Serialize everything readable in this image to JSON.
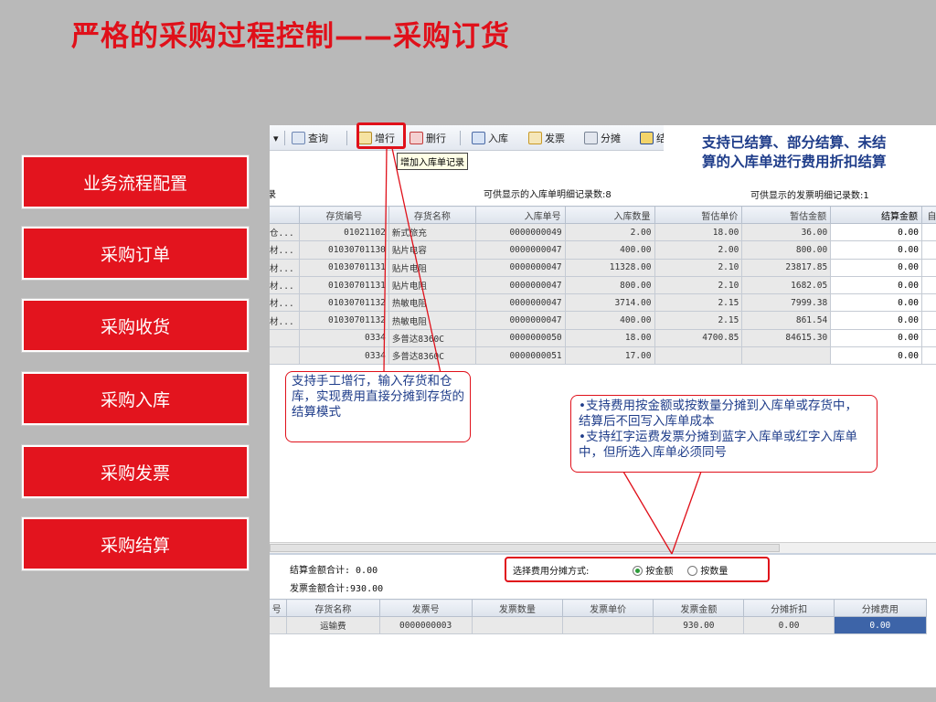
{
  "slide": {
    "title": "严格的采购过程控制——采购订货",
    "nav": [
      "业务流程配置",
      "采购订单",
      "采购收货",
      "采购入库",
      "采购发票",
      "采购结算"
    ]
  },
  "toolbar": {
    "query": "查询",
    "add_row": "增行",
    "delete_row": "删行",
    "stock_in": "入库",
    "invoice": "发票",
    "allocate": "分摊",
    "settle": "结算",
    "tooltip": "增加入库单记录"
  },
  "callouts": {
    "top_right": [
      "支持已结算、部分结算、未结",
      "算的入库单进行费用折扣结算"
    ],
    "left": "支持手工增行，输入存货和仓库，实现费用直接分摊到存货的结算模式",
    "right": [
      "•支持费用按金额或按数量分摊到入库单或存货中，结算后不回写入库单成本",
      "•支持红字运费发票分摊到蓝字入库单或红字入库单中，但所选入库单必须同号"
    ]
  },
  "upper_grid": {
    "label_left": "录",
    "count_receipt": "可供显示的入库单明细记录数:8",
    "count_invoice": "可供显示的发票明细记录数:1",
    "columns": [
      "",
      "存货编号",
      "存货名称",
      "入库单号",
      "入库数量",
      "暂估单价",
      "暂估金额",
      "结算金额",
      "自"
    ],
    "rows": [
      [
        "仓...",
        "01021102",
        "新式旅充",
        "0000000049",
        "2.00",
        "18.00",
        "36.00",
        "0.00"
      ],
      [
        "材...",
        "01030701130",
        "贴片电容",
        "0000000047",
        "400.00",
        "2.00",
        "800.00",
        "0.00"
      ],
      [
        "材...",
        "01030701131",
        "贴片电阻",
        "0000000047",
        "11328.00",
        "2.10",
        "23817.85",
        "0.00"
      ],
      [
        "材...",
        "01030701131",
        "贴片电阻",
        "0000000047",
        "800.00",
        "2.10",
        "1682.05",
        "0.00"
      ],
      [
        "材...",
        "01030701132",
        "热敏电阻",
        "0000000047",
        "3714.00",
        "2.15",
        "7999.38",
        "0.00"
      ],
      [
        "材...",
        "01030701132",
        "热敏电阻",
        "0000000047",
        "400.00",
        "2.15",
        "861.54",
        "0.00"
      ],
      [
        "",
        "0334",
        "多普达8360C",
        "0000000050",
        "18.00",
        "4700.85",
        "84615.30",
        "0.00"
      ],
      [
        "",
        "0334",
        "多普达8360C",
        "0000000051",
        "17.00",
        "",
        "",
        "0.00"
      ]
    ]
  },
  "summary": {
    "settle_total": "结算金额合计: 0.00",
    "invoice_total": "发票金额合计:930.00",
    "alloc_label": "选择费用分摊方式:",
    "by_amount": "按金额",
    "by_quantity": "按数量"
  },
  "lower_grid": {
    "columns": [
      "号",
      "存货名称",
      "发票号",
      "发票数量",
      "发票单价",
      "发票金额",
      "分摊折扣",
      "分摊费用"
    ],
    "rows": [
      [
        "",
        "运输费",
        "0000000003",
        "",
        "",
        "930.00",
        "0.00",
        "0.00"
      ]
    ]
  },
  "colors": {
    "accent_red": "#e0101a",
    "callout_blue": "#1f3d8a",
    "selected_cell": "#3d64a8"
  }
}
